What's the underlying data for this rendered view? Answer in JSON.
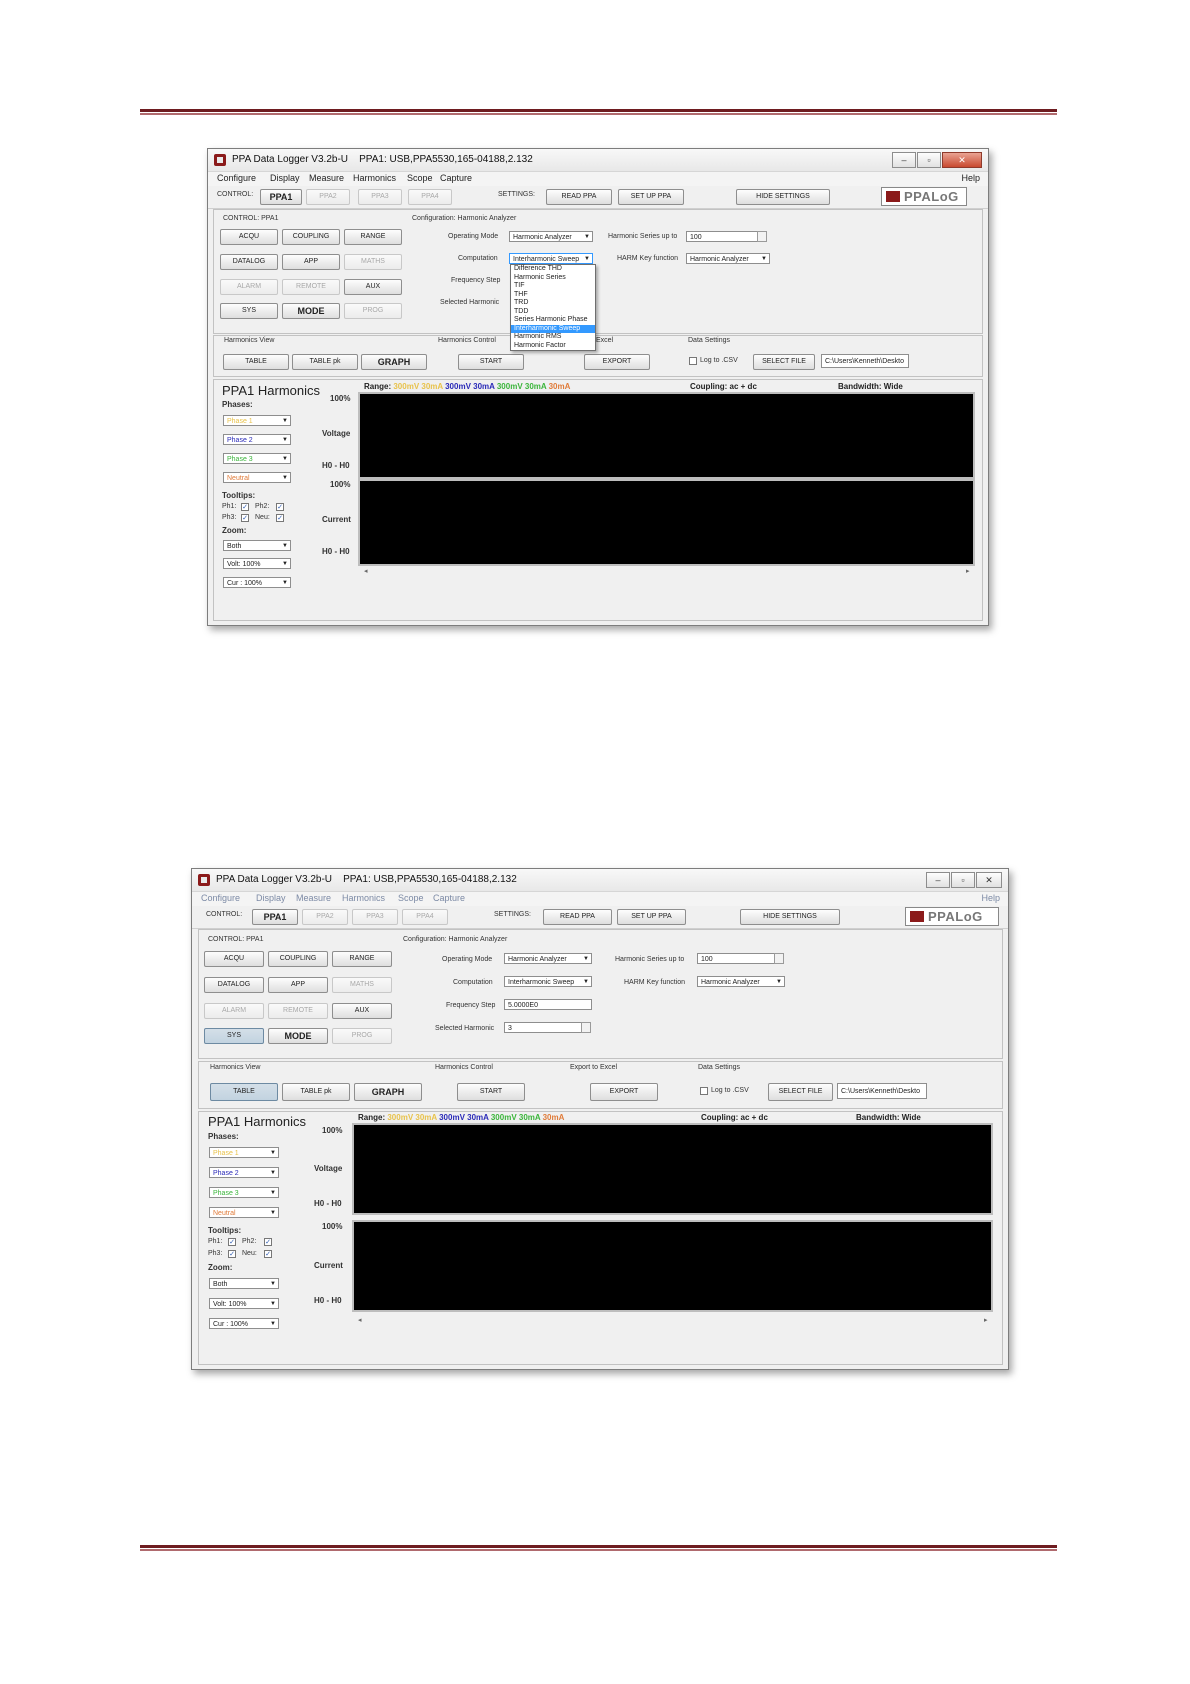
{
  "app": {
    "title": "PPA Data Logger V3.2b-U",
    "connection": "PPA1: USB,PPA5530,165-04188,2.132",
    "menu": [
      "Configure",
      "Display",
      "Measure",
      "Harmonics",
      "Scope",
      "Capture"
    ],
    "help": "Help",
    "control_label": "CONTROL:",
    "ppa_tabs": [
      "PPA1",
      "PPA2",
      "PPA3",
      "PPA4"
    ],
    "settings_label": "SETTINGS:",
    "read_ppa": "READ PPA",
    "set_up_ppa": "SET UP PPA",
    "hide_settings": "HIDE SETTINGS",
    "logo": "PPALoG",
    "control_ppa1": "CONTROL: PPA1",
    "control_buttons": [
      "ACQU",
      "COUPLING",
      "RANGE",
      "DATALOG",
      "APP",
      "MATHS",
      "ALARM",
      "REMOTE",
      "AUX",
      "SYS",
      "MODE",
      "PROG"
    ],
    "config_title": "Configuration: Harmonic Analyzer",
    "operating_mode_label": "Operating Mode",
    "operating_mode_value": "Harmonic Analyzer",
    "computation_label": "Computation",
    "computation_value": "Interharmonic Sweep",
    "frequency_step_label": "Frequency Step",
    "frequency_step_value": "5.0000E0",
    "selected_harmonic_label": "Selected Harmonic",
    "selected_harmonic_value": "3",
    "harmonic_series_label": "Harmonic Series up to",
    "harmonic_series_value": "100",
    "harm_key_label": "HARM Key function",
    "harm_key_value": "Harmonic Analyzer",
    "computation_options": [
      "Difference THD",
      "Harmonic Series",
      "TIF",
      "THF",
      "TRD",
      "TDD",
      "Series Harmonic Phase",
      "Interharmonic Sweep",
      "Harmonic RMS",
      "Harmonic Factor"
    ],
    "harmonics_view_label": "Harmonics View",
    "table": "TABLE",
    "table_pk": "TABLE pk",
    "graph": "GRAPH",
    "harmonics_control_label": "Harmonics Control",
    "start": "START",
    "export_label_top": "Excel",
    "export_label_bottom": "Export to Excel",
    "export": "EXPORT",
    "data_settings_label": "Data Settings",
    "log_csv": "Log to .CSV",
    "select_file": "SELECT FILE",
    "file_path": "C:\\Users\\Kenneth\\Deskto",
    "harm_title": "PPA1 Harmonics",
    "phases_label": "Phases:",
    "phases": [
      "Phase 1",
      "Phase 2",
      "Phase 3",
      "Neutral"
    ],
    "phase_colors": [
      "#e8c24a",
      "#2a2ab8",
      "#3ab53a",
      "#e07b39"
    ],
    "tooltips_label": "Tooltips:",
    "tooltips": [
      "Ph1:",
      "Ph2:",
      "Ph3:",
      "Neu:"
    ],
    "zoom_label": "Zoom:",
    "zoom_both": "Both",
    "zoom_volt": "Volt: 100%",
    "zoom_cur": "Cur : 100%",
    "range_label": "Range:",
    "range_values": [
      "300mV 30mA",
      "300mV 30mA",
      "300mV 30mA",
      "30mA"
    ],
    "coupling": "Coupling: ac + dc",
    "bandwidth": "Bandwidth: Wide",
    "pct_100": "100%",
    "voltage": "Voltage",
    "current": "Current",
    "h0": "H0 - H0"
  }
}
